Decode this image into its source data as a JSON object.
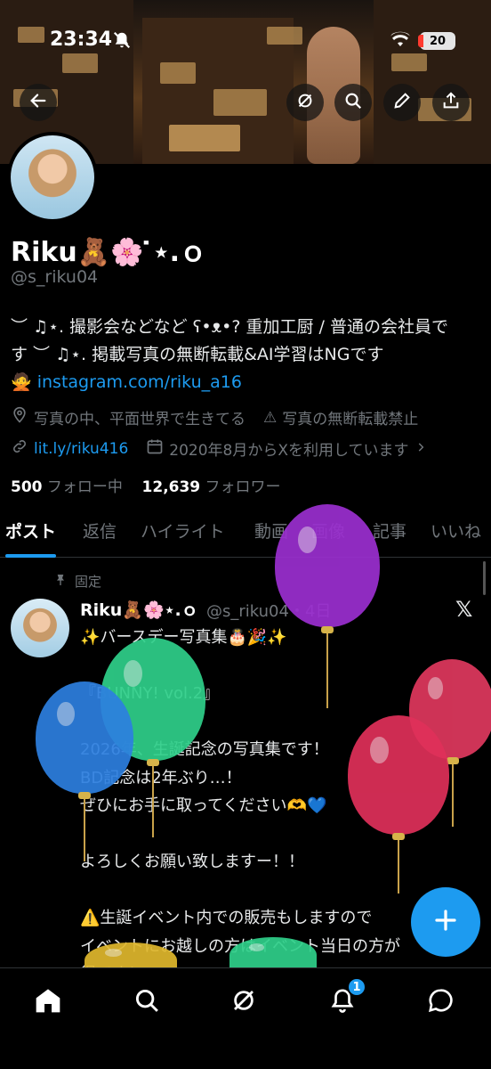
{
  "status_bar": {
    "time": "23:34",
    "battery": "20"
  },
  "profile": {
    "name": "Riku🧸🌸 ̇⋆.ｏ",
    "handle": "@s_riku04",
    "bio_line1": "︶ ♫⋆. 撮影会などなど ʕ•ᴥ•? 重加工厨 / 普通の会社員で",
    "bio_line2": "す ︶ ♫⋆. 掲載写真の無断転載&AI学習はNGです",
    "bio_link_emoji": "🙅",
    "bio_link": "instagram.com/riku_a16",
    "location": "写真の中、平面世界で生きてる",
    "warning": "写真の無断転載禁止",
    "website": "lit.ly/riku416",
    "joined": "2020年8月からXを利用しています",
    "following_count": "500",
    "following_label": "フォロー中",
    "followers_count": "12,639",
    "followers_label": "フォロワー"
  },
  "tabs": [
    "ポスト",
    "返信",
    "ハイライト",
    "動画",
    "画像",
    "記事",
    "いいね"
  ],
  "pinned_post": {
    "pinned_label": "固定",
    "author_name": "Riku🧸🌸⋆.ｏ",
    "author_handle": "@s_riku04・4日",
    "text": "✨バースデー写真集🎂🎉✨\n\n『BUNNY! vol.2』\n\n2026年、生誕記念の写真集です！\nBD記念は2年ぶり…！\nぜひにお手に取ってください🫶💙\n\nよろしくお願い致しますー！！\n\n⚠️生誕イベント内での販売もしますので\nイベントにお越しの方はイベント当日の方が\n得です！"
  },
  "nav": {
    "notification_badge": "1"
  },
  "colors": {
    "accent": "#1d9bf0",
    "background": "#000000",
    "muted": "#71767b"
  }
}
